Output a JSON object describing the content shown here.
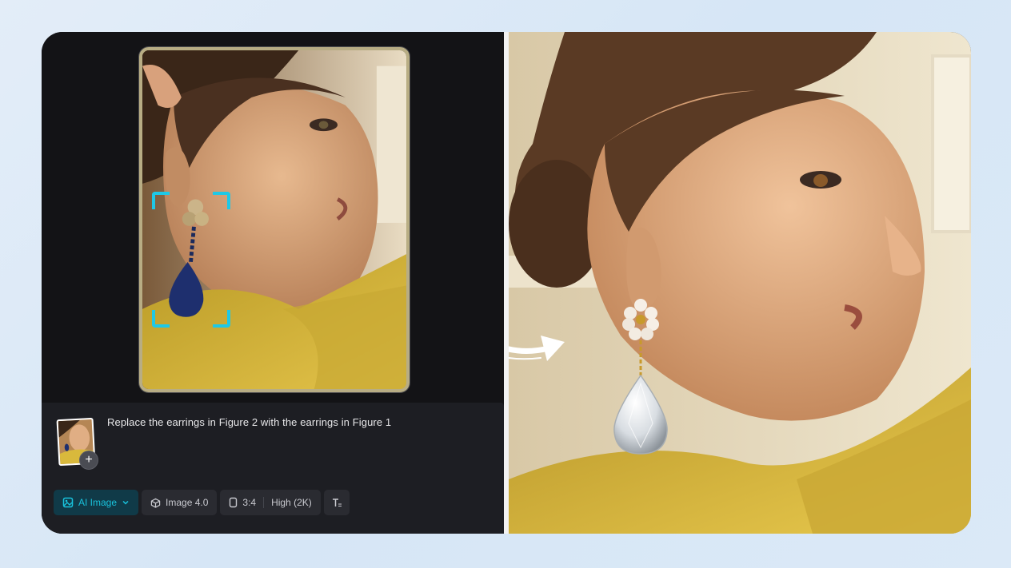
{
  "prompt": {
    "text": "Replace the earrings in Figure 2 with the earrings in Figure 1",
    "add_symbol": "+"
  },
  "toolbar": {
    "mode_label": "AI Image",
    "model_label": "Image 4.0",
    "ratio_label": "3:4",
    "quality_label": "High (2K)"
  },
  "icons": {
    "mode": "image-icon",
    "mode_dropdown": "chevron-down-icon",
    "model": "cube-icon",
    "ratio": "portrait-rect-icon",
    "text_style": "text-format-icon",
    "arrow": "curved-arrow-icon"
  },
  "colors": {
    "accent": "#19c2dc",
    "panel_bg": "#131316",
    "prompt_bg": "#1d1e23",
    "chip_bg": "#2a2b31",
    "page_bg": "#dbe9f7"
  }
}
